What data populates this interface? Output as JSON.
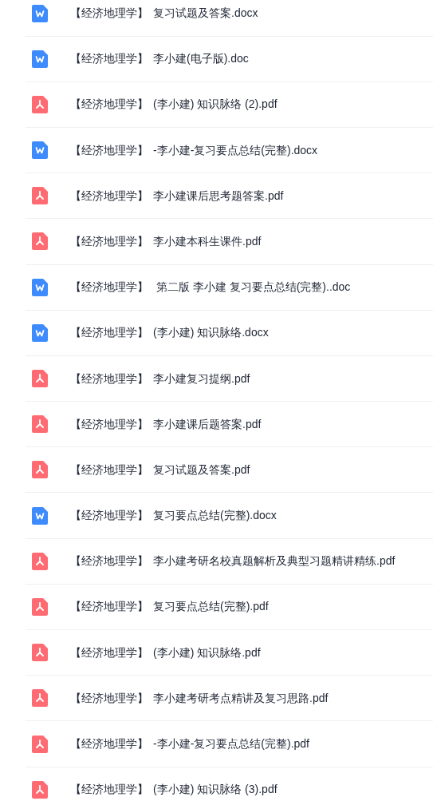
{
  "files": [
    {
      "kind": "word",
      "prefix": "【经济地理学】",
      "title": "复习试题及答案.docx"
    },
    {
      "kind": "word",
      "prefix": "【经济地理学】",
      "title": "李小建(电子版).doc"
    },
    {
      "kind": "pdf",
      "prefix": "【经济地理学】",
      "title": "(李小建) 知识脉络 (2).pdf"
    },
    {
      "kind": "word",
      "prefix": "【经济地理学】",
      "title": "-李小建-复习要点总结(完整).docx"
    },
    {
      "kind": "pdf",
      "prefix": "【经济地理学】",
      "title": "李小建课后思考题答案.pdf"
    },
    {
      "kind": "pdf",
      "prefix": "【经济地理学】",
      "title": "李小建本科生课件.pdf"
    },
    {
      "kind": "word",
      "prefix": "【经济地理学】",
      "title": " 第二版 李小建 复习要点总结(完整)..doc"
    },
    {
      "kind": "word",
      "prefix": "【经济地理学】",
      "title": "(李小建) 知识脉络.docx"
    },
    {
      "kind": "pdf",
      "prefix": "【经济地理学】",
      "title": "李小建复习提纲.pdf"
    },
    {
      "kind": "pdf",
      "prefix": "【经济地理学】",
      "title": "李小建课后题答案.pdf"
    },
    {
      "kind": "pdf",
      "prefix": "【经济地理学】",
      "title": "复习试题及答案.pdf"
    },
    {
      "kind": "word",
      "prefix": "【经济地理学】",
      "title": "复习要点总结(完整).docx"
    },
    {
      "kind": "pdf",
      "prefix": "【经济地理学】",
      "title": "李小建考研名校真题解析及典型习题精讲精练.pdf"
    },
    {
      "kind": "pdf",
      "prefix": "【经济地理学】",
      "title": "复习要点总结(完整).pdf"
    },
    {
      "kind": "pdf",
      "prefix": "【经济地理学】",
      "title": "(李小建) 知识脉络.pdf"
    },
    {
      "kind": "pdf",
      "prefix": "【经济地理学】",
      "title": "李小建考研考点精讲及复习思路.pdf"
    },
    {
      "kind": "pdf",
      "prefix": "【经济地理学】",
      "title": "-李小建-复习要点总结(完整).pdf"
    },
    {
      "kind": "pdf",
      "prefix": "【经济地理学】",
      "title": "(李小建) 知识脉络 (3).pdf"
    }
  ]
}
